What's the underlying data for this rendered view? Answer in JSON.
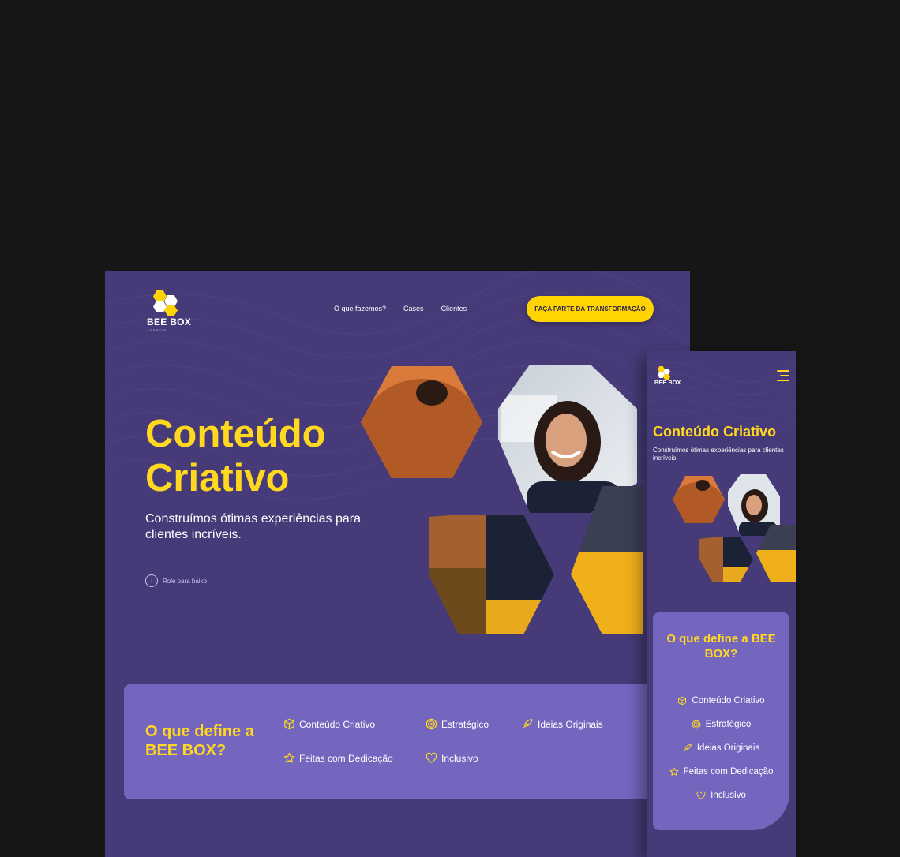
{
  "colors": {
    "background": "#161616",
    "brand_purple": "#463b78",
    "card_purple": "#7466bf",
    "accent_yellow": "#ffd81f",
    "cta_yellow": "#ffd400"
  },
  "brand": {
    "name": "BEE BOX",
    "tagline": "AGENCIA"
  },
  "desktop": {
    "nav": [
      {
        "label": "O que fazemos?"
      },
      {
        "label": "Cases"
      },
      {
        "label": "Clientes"
      }
    ],
    "cta_label": "FAÇA PARTE DA TRANSFORMAÇÃO",
    "hero": {
      "title": "Conteúdo Criativo",
      "subtitle": "Construímos ótimas experiências para clientes incríveis.",
      "scroll_label": "Role para baixo",
      "scroll_icon": "arrow-down-circle-icon"
    },
    "define": {
      "title": "O que define a BEE BOX?",
      "features": [
        {
          "label": "Conteúdo Criativo",
          "icon": "box-icon"
        },
        {
          "label": "Estratégico",
          "icon": "target-icon"
        },
        {
          "label": "Ideias Originais",
          "icon": "feather-icon"
        },
        {
          "label": "Feitas com Dedicação",
          "icon": "star-icon"
        },
        {
          "label": "Inclusivo",
          "icon": "heart-icon"
        }
      ]
    }
  },
  "mobile": {
    "menu_icon": "hamburger-menu-icon",
    "hero": {
      "title": "Conteúdo Criativo",
      "subtitle": "Construímos ótimas experiências para clientes incríveis."
    },
    "define": {
      "title": "O que define a BEE BOX?",
      "features": [
        {
          "label": "Conteúdo Criativo",
          "icon": "box-icon"
        },
        {
          "label": "Estratégico",
          "icon": "target-icon"
        },
        {
          "label": "Ideias Originais",
          "icon": "feather-icon"
        },
        {
          "label": "Feitas com Dedicação",
          "icon": "star-icon"
        },
        {
          "label": "Inclusivo",
          "icon": "heart-icon"
        }
      ]
    }
  }
}
